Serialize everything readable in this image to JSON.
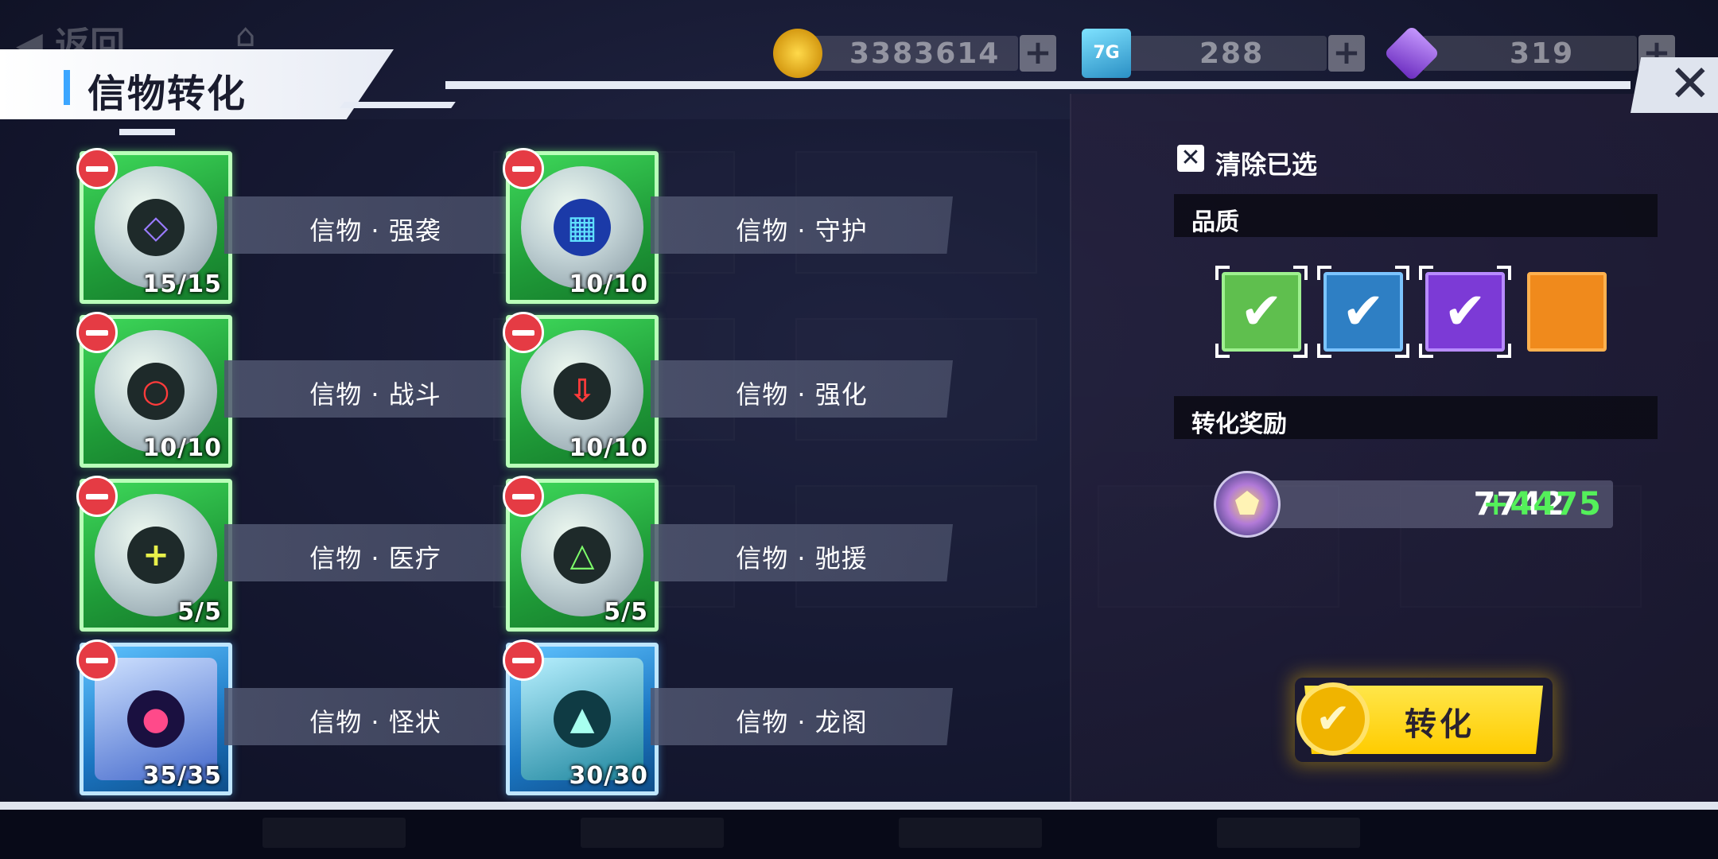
{
  "header": {
    "back_label": "返回",
    "title": "信物转化",
    "close_glyph": "✕"
  },
  "currencies": [
    {
      "icon": "gold-coin-icon",
      "value": "3383614",
      "plus": "+"
    },
    {
      "icon": "card-7g-icon",
      "value": "288",
      "plus": "+"
    },
    {
      "icon": "purple-gem-icon",
      "value": "319",
      "plus": "+"
    }
  ],
  "items": [
    {
      "name": "信物 · 强袭",
      "count": "15/15",
      "quality": "green",
      "symbol": "◇"
    },
    {
      "name": "信物 · 守护",
      "count": "10/10",
      "quality": "green",
      "symbol": "▦"
    },
    {
      "name": "信物 · 战斗",
      "count": "10/10",
      "quality": "green",
      "symbol": "○"
    },
    {
      "name": "信物 · 强化",
      "count": "10/10",
      "quality": "green",
      "symbol": "⇩"
    },
    {
      "name": "信物 · 医疗",
      "count": "5/5",
      "quality": "green",
      "symbol": "+"
    },
    {
      "name": "信物 · 驰援",
      "count": "5/5",
      "quality": "green",
      "symbol": "△"
    },
    {
      "name": "信物 · 怪状",
      "count": "35/35",
      "quality": "blue",
      "symbol": "●"
    },
    {
      "name": "信物 · 龙阁",
      "count": "30/30",
      "quality": "blue",
      "symbol": "▲"
    }
  ],
  "filters": {
    "clear_label": "清除已选",
    "clear_glyph": "✕",
    "quality_label": "品质",
    "qualities": [
      {
        "color": "#5fbf4e",
        "checked": true,
        "glyph": "✔"
      },
      {
        "color": "#2e7fc4",
        "checked": true,
        "glyph": "✔"
      },
      {
        "color": "#7c3ad6",
        "checked": true,
        "glyph": "✔"
      },
      {
        "color": "#f08a1c",
        "checked": false,
        "glyph": ""
      }
    ]
  },
  "reward": {
    "label": "转化奖励",
    "base": "7742",
    "bonus": "+4475"
  },
  "convert": {
    "label": "转化",
    "glyph": "✔"
  },
  "colors": {
    "accent": "#3ca6ff",
    "green_card": "#2fc24b",
    "blue_card": "#1b76c2",
    "bonus_green": "#54f05a",
    "convert_yellow": "#ffd400"
  }
}
